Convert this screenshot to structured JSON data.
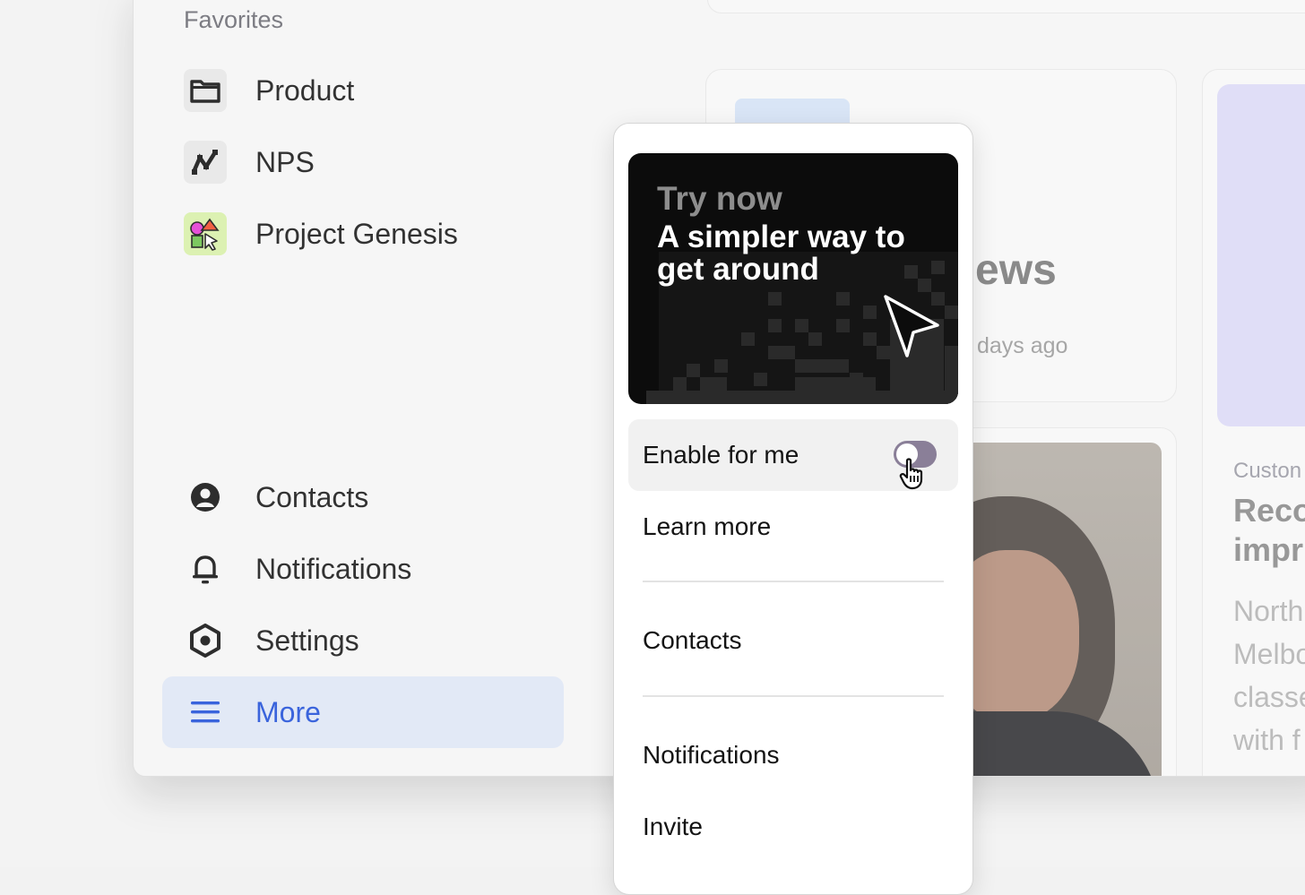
{
  "sidebar": {
    "favorites_label": "Favorites",
    "favorites": [
      {
        "label": "Product",
        "icon": "folder-icon"
      },
      {
        "label": "NPS",
        "icon": "chart-line-icon"
      },
      {
        "label": "Project Genesis",
        "icon": "shapes-icon"
      }
    ],
    "bottom": [
      {
        "label": "Contacts",
        "icon": "user-circle-icon"
      },
      {
        "label": "Notifications",
        "icon": "bell-icon"
      },
      {
        "label": "Settings",
        "icon": "hex-gear-icon"
      },
      {
        "label": "More",
        "icon": "menu-icon",
        "active": true
      }
    ]
  },
  "background": {
    "card_a_title": "views",
    "card_a_subtitle": "days ago",
    "card_c_tag": "Custon",
    "card_c_heading": [
      "Reco",
      "impr"
    ],
    "card_c_body": [
      "North",
      "Melbo",
      "classe",
      "with f"
    ]
  },
  "popover": {
    "promo_eyebrow": "Try now",
    "promo_headline": "A simpler way to get around",
    "enable_label": "Enable for me",
    "learn_more_label": "Learn more",
    "items": [
      "Contacts",
      "Notifications",
      "Invite"
    ]
  },
  "colors": {
    "accent": "#1f4fd8",
    "active_bg": "#dfe6f5",
    "toggle_off": "#8a7f98",
    "promo_bg": "#0c0c0c"
  }
}
